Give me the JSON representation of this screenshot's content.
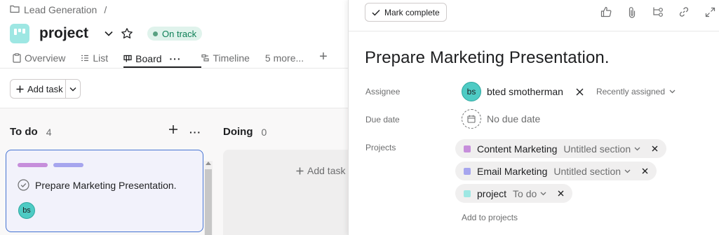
{
  "breadcrumb": {
    "parent": "Lead Generation",
    "separator": "/"
  },
  "project": {
    "title": "project",
    "status": "On track",
    "status_color": "#58a182",
    "icon_color": "#9ee7e3"
  },
  "tabs": [
    {
      "label": "Overview",
      "icon": "clipboard-icon"
    },
    {
      "label": "List",
      "icon": "list-icon"
    },
    {
      "label": "Board",
      "icon": "board-icon",
      "active": true
    },
    {
      "label": "Timeline",
      "icon": "timeline-icon"
    },
    {
      "label": "5 more..."
    }
  ],
  "toolbar": {
    "add_task_label": "Add task"
  },
  "board": {
    "columns": [
      {
        "name": "To do",
        "count": "4"
      },
      {
        "name": "Doing",
        "count": "0"
      }
    ],
    "card": {
      "title": "Prepare Marketing Presentation.",
      "assignee_initials": "bs",
      "tag_colors": [
        "#c68edb",
        "#a6a5ee"
      ]
    },
    "add_task_label": "Add task"
  },
  "detail": {
    "mark_complete_label": "Mark complete",
    "task_title": "Prepare Marketing Presentation.",
    "labels": {
      "assignee": "Assignee",
      "due_date": "Due date",
      "projects": "Projects"
    },
    "assignee": {
      "initials": "bs",
      "name": "bted smotherman",
      "recent_label": "Recently assigned"
    },
    "due_date": {
      "value": "No due date"
    },
    "projects": [
      {
        "name": "Content Marketing",
        "section": "Untitled section",
        "color": "#c68edb"
      },
      {
        "name": "Email Marketing",
        "section": "Untitled section",
        "color": "#a6a5ee"
      },
      {
        "name": "project",
        "section": "To do",
        "color": "#9ee7e3"
      }
    ],
    "add_to_projects_label": "Add to projects"
  },
  "colors": {
    "accent_border": "#4573d2",
    "avatar": "#4ecbc4"
  }
}
